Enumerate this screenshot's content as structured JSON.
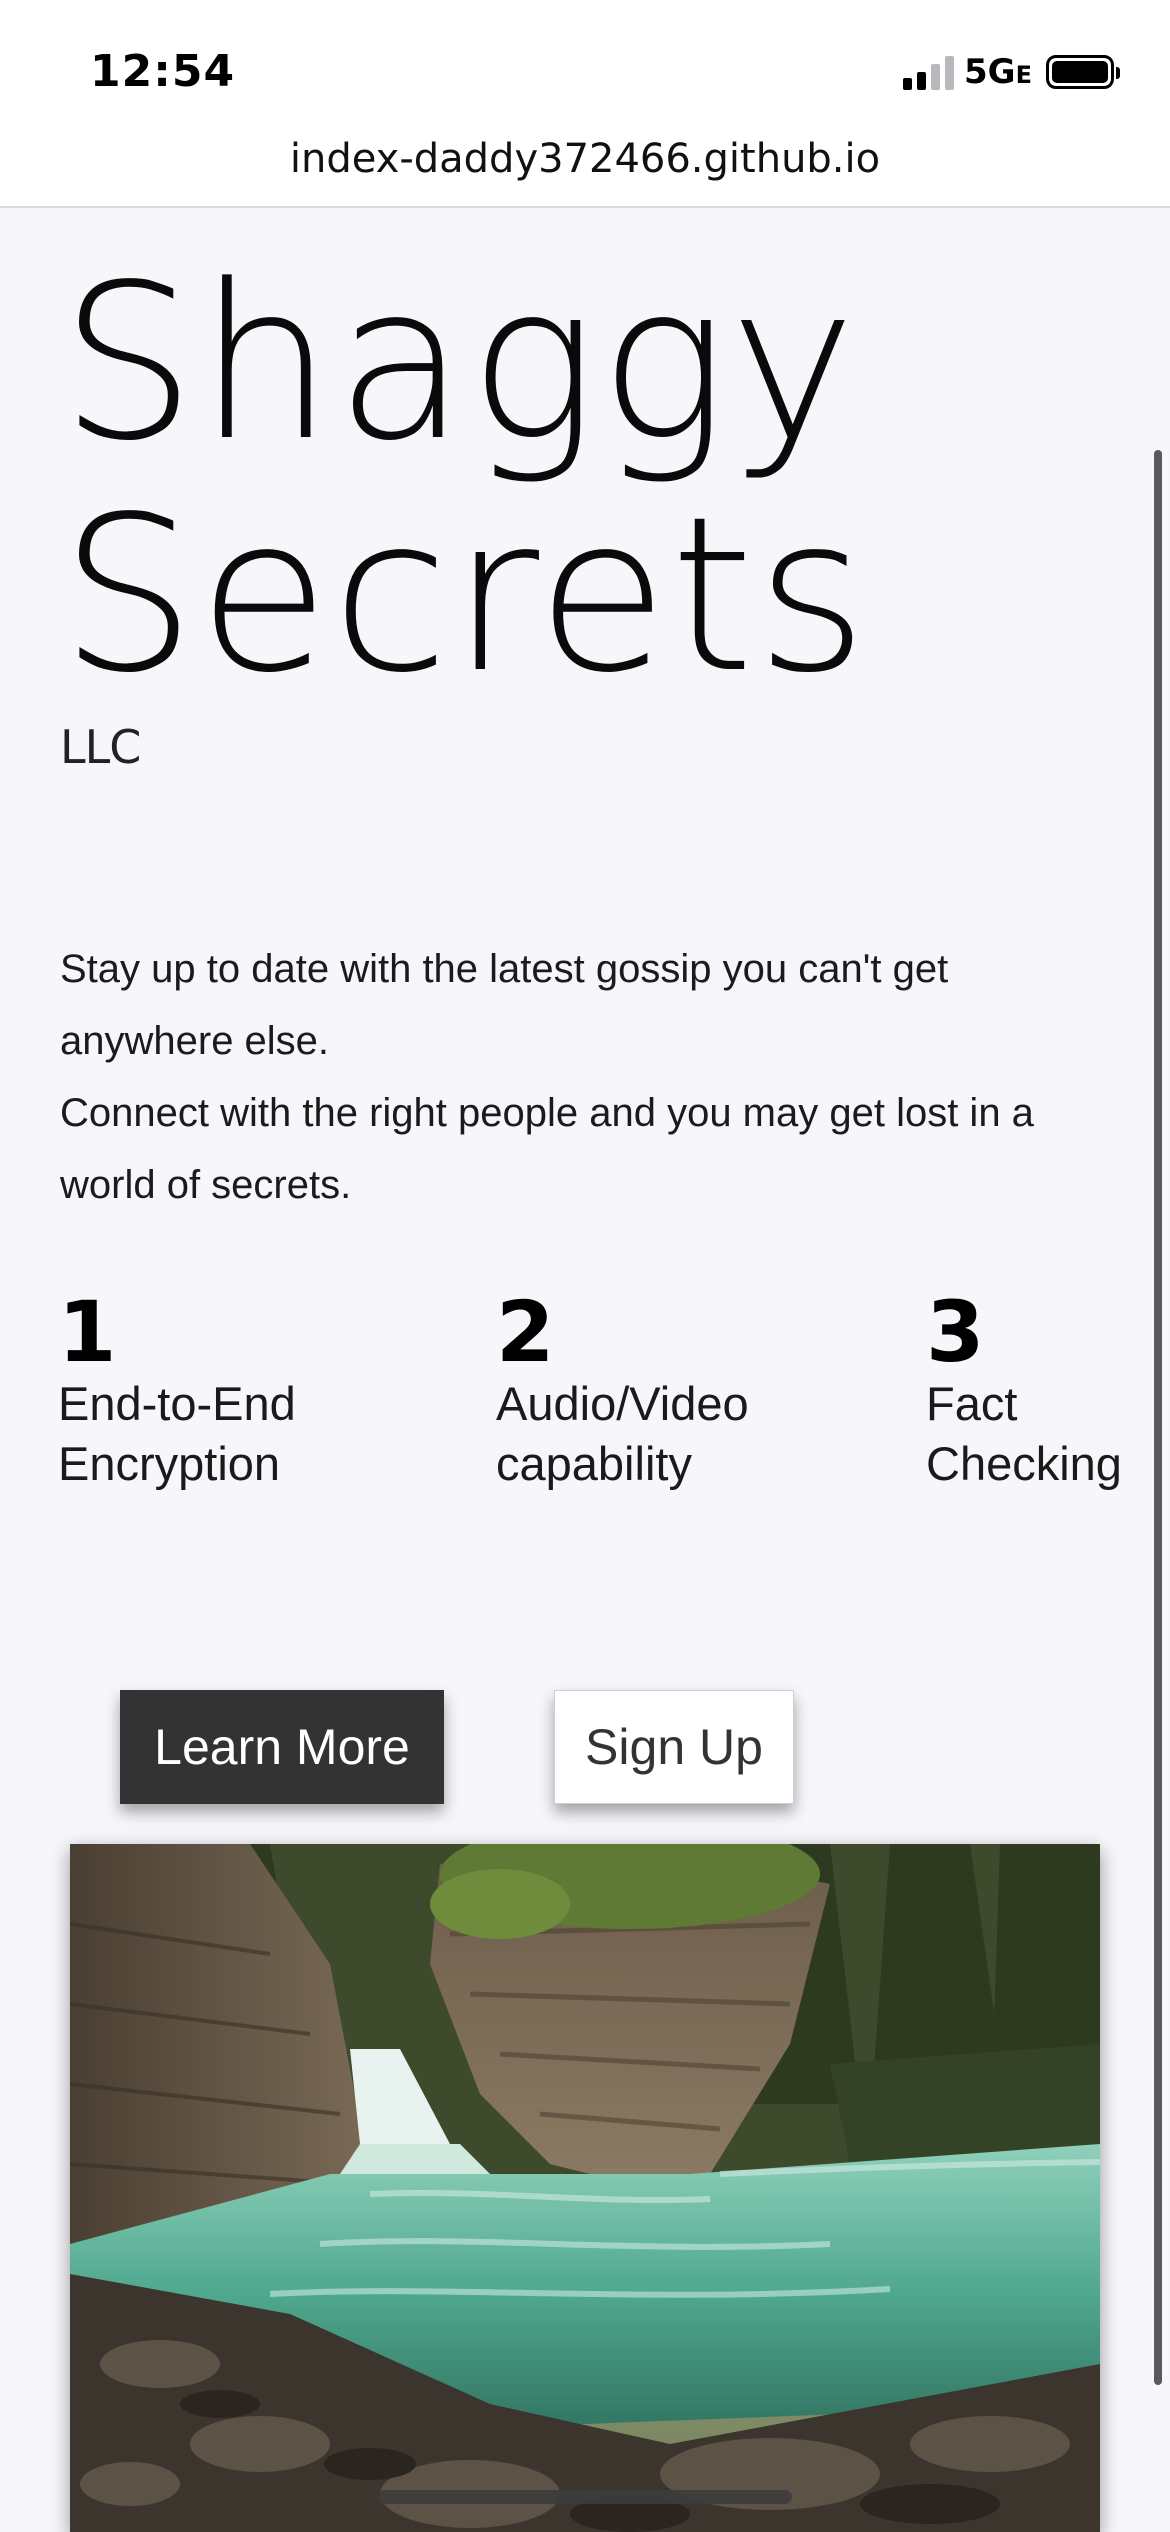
{
  "status_bar": {
    "time": "12:54",
    "network": "5G",
    "network_suffix": "E",
    "battery_icon": "battery-full-icon",
    "signal_icon": "signal-bars-icon"
  },
  "browser": {
    "url": "index-daddy372466.github.io"
  },
  "hero": {
    "title_line1": "Shaggy",
    "title_line2": "Secrets",
    "subtitle": "LLC"
  },
  "intro": {
    "line1": "Stay up to date with the latest gossip you can't get anywhere else.",
    "line2": "Connect with the right people and you may get lost in a world of secrets."
  },
  "features": [
    {
      "number": "1",
      "label_line1": "End-to-End",
      "label_line2": "Encryption"
    },
    {
      "number": "2",
      "label_line1": "Audio/Video",
      "label_line2": "capability"
    },
    {
      "number": "3",
      "label_line1": "Fact",
      "label_line2": "Checking"
    }
  ],
  "buttons": {
    "learn_more": "Learn More",
    "sign_up": "Sign Up"
  },
  "colors": {
    "page_bg": "#f7f6fb",
    "learn_more_bg": "#333333",
    "sign_up_bg": "#ffffff",
    "water": "#5fb39a"
  }
}
